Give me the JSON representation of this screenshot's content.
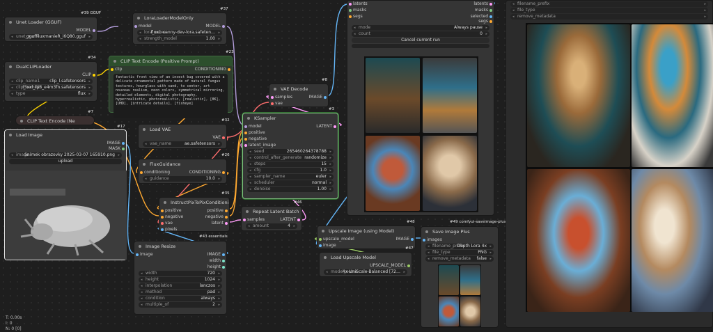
{
  "nodes": {
    "unet": {
      "title": "Unet Loader (GGUF)",
      "badge": "#39 GGUF",
      "out_model": "MODEL",
      "w_label": "unet_name",
      "w_value": "ggufFluxmanieR_i6Q80.gguf"
    },
    "lora": {
      "title": "LoraLoaderModelOnly",
      "badge": "#37",
      "in_model": "model",
      "out_model": "MODEL",
      "w1_label": "lora_name",
      "w1_value": "flux1-canny-dev-lora.safeten…",
      "w2_label": "strength_model",
      "w2_value": "1.00"
    },
    "dualclip": {
      "title": "DualCLIPLoader",
      "badge": "#34",
      "out_clip": "CLIP",
      "w1_label": "clip_name1",
      "w1_value": "clip_l.safetensors",
      "w2_label": "clip_name2",
      "w2_value": "t5xxl_fp8_e4m3fn.safetensors",
      "w3_label": "type",
      "w3_value": "flux"
    },
    "cliptext": {
      "title": "CLIP Text Encode (Positive Prompt)",
      "badge": "#23",
      "in_clip": "clip",
      "out_cond": "CONDITIONING",
      "text": "fantastic front view of an insect bug covered with a delicate ornamental pattern made of natural fungus textures, hourglass with sand, to center, art nouveau realism, neon colors, symmetrical mirroring, detailed elements, digital photography, hyperrealistic, photorealistic, [realistic], [8K], [UHD], [intricate details], [fisheye]"
    },
    "cliptext_neg": {
      "title": "CLIP Text Encode (Ne",
      "badge": "#7"
    },
    "loadimage": {
      "title": "Load Image",
      "badge": "#17",
      "out_image": "IMAGE",
      "out_mask": "MASK",
      "w_label": "image",
      "w_value": "Snímek obrazovky 2025-03-07 165910.png",
      "upload": "upload"
    },
    "loadvae": {
      "title": "Load VAE",
      "badge": "#32",
      "out_vae": "VAE",
      "w_label": "vae_name",
      "w_value": "ae.safetensors"
    },
    "fluxguid": {
      "title": "FluxGuidance",
      "badge": "#26",
      "in_cond": "conditioning",
      "out_cond": "CONDITIONING",
      "w_label": "guidance",
      "w_value": "10.0"
    },
    "instruct": {
      "title": "InstructPixToPixConditioning",
      "badge": "#35",
      "in1": "positive",
      "in2": "negative",
      "in3": "vae",
      "in4": "pixels",
      "out1": "positive",
      "out2": "negative",
      "out3": "latent",
      "footer_badge": "#43 essentials"
    },
    "resize": {
      "title": "Image Resize",
      "in_image": "image",
      "out1": "IMAGE",
      "out2": "width",
      "out3": "height",
      "widgets": [
        {
          "l": "width",
          "v": "720"
        },
        {
          "l": "height",
          "v": "1024"
        },
        {
          "l": "interpolation",
          "v": "lanczos"
        },
        {
          "l": "method",
          "v": "pad"
        },
        {
          "l": "condition",
          "v": "always"
        },
        {
          "l": "multiple_of",
          "v": "2"
        }
      ]
    },
    "vaedecode": {
      "title": "VAE Decode",
      "badge": "#8",
      "in1": "samples",
      "in2": "vae",
      "out1": "IMAGE"
    },
    "ksampler": {
      "title": "KSampler",
      "badge": "#3",
      "in1": "model",
      "in2": "positive",
      "in3": "negative",
      "in4": "latent_image",
      "out1": "LATENT",
      "widgets": [
        {
          "l": "seed",
          "v": "265460264378788"
        },
        {
          "l": "control_after_generate",
          "v": "randomize"
        },
        {
          "l": "steps",
          "v": "15"
        },
        {
          "l": "cfg",
          "v": "1.0"
        },
        {
          "l": "sampler_name",
          "v": "euler"
        },
        {
          "l": "scheduler",
          "v": "normal"
        },
        {
          "l": "denoise",
          "v": "1.00"
        }
      ]
    },
    "repeat": {
      "title": "Repeat Latent Batch",
      "badge": "#46",
      "in1": "samples",
      "out1": "LATENT",
      "w_label": "amount",
      "w_value": "4"
    },
    "upscale": {
      "title": "Upscale Image (using Model)",
      "badge": "#48",
      "in1": "upscale_model",
      "in2": "image",
      "out1": "IMAGE"
    },
    "loadup": {
      "title": "Load Upscale Model",
      "badge": "#47",
      "out1": "UPSCALE_MODEL",
      "w_label": "model_name",
      "w_value": "4x-UniScale-Balanced [72…"
    },
    "saveplus": {
      "title": "Save Image Plus",
      "badge": "#49 comfyui-saveimage-plus",
      "in1": "images",
      "w1_label": "filename_prefix",
      "w1_value": "Depth Lora 4x",
      "w2_label": "file_type",
      "w2_value": "PNG",
      "w3_label": "remove_metadata",
      "w3_value": "false"
    },
    "preview": {
      "in1": "latents",
      "in2": "masks",
      "in3": "segs",
      "out1": "latents",
      "out2": "masks",
      "out3": "selected",
      "out4": "segs",
      "w1_label": "mode",
      "w1_value": "Always pause",
      "w2_label": "count",
      "w2_value": "0",
      "cancel": "Cancel current run"
    },
    "rightpanel": {
      "in1": "filename_prefix",
      "in2": "file_type",
      "in3": "remove_metadata"
    }
  },
  "status": {
    "line1": "T: 0.00s",
    "line2": "I: 0",
    "line3": "N: 0 [0]"
  },
  "colors": {
    "model": "#b39ddb",
    "clip": "#ffd500",
    "conditioning": "#ffa931",
    "latent": "#ff9cf9",
    "vae": "#ff6e6e",
    "image": "#64b5f6",
    "mask": "#81c784"
  }
}
